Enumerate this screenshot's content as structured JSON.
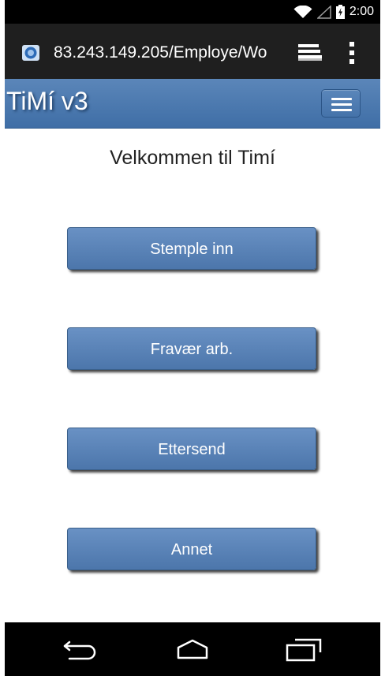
{
  "status_bar": {
    "time": "2:00",
    "icons": [
      "wifi-icon",
      "signal-icon",
      "battery-charging-icon"
    ]
  },
  "browser": {
    "url": "83.243.149.205/Employe/Wo",
    "icons": [
      "favicon-icon",
      "tabs-icon",
      "overflow-menu-icon"
    ]
  },
  "header": {
    "title": "TiMí v3",
    "menu_icon": "hamburger-menu-icon"
  },
  "main": {
    "welcome": "Velkommen til Timí",
    "buttons": [
      {
        "label": "Stemple inn"
      },
      {
        "label": "Fravær arb."
      },
      {
        "label": "Ettersend"
      },
      {
        "label": "Annet"
      }
    ]
  },
  "nav_bar": {
    "icons": [
      "back-icon",
      "home-icon",
      "recents-icon"
    ]
  },
  "colors": {
    "header_blue": "#4a79b1",
    "button_blue": "#5a84b9",
    "status_bar": "#000000",
    "address_bar": "#1f1f1f"
  }
}
